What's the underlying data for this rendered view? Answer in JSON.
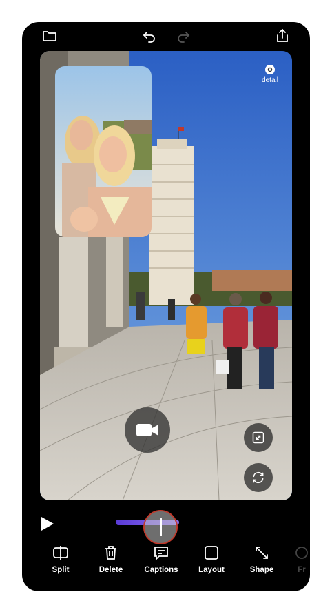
{
  "header": {
    "folder_icon": "folder-icon",
    "undo_icon": "undo-icon",
    "redo_icon": "redo-icon",
    "share_icon": "share-icon"
  },
  "canvas": {
    "detail_label": "detail",
    "expand_icon": "expand-icon",
    "rotate_icon": "rotate-camera-icon",
    "camera_icon": "video-camera-icon"
  },
  "playback": {
    "play_icon": "play-icon",
    "progress_fraction": 0.5
  },
  "toolbar": {
    "items": [
      {
        "label": "Split",
        "icon": "split-icon"
      },
      {
        "label": "Delete",
        "icon": "trash-icon"
      },
      {
        "label": "Captions",
        "icon": "captions-icon"
      },
      {
        "label": "Layout",
        "icon": "layout-icon"
      },
      {
        "label": "Shape",
        "icon": "shape-icon"
      },
      {
        "label": "Fr",
        "icon": "frame-icon"
      }
    ]
  },
  "colors": {
    "accent": "#6a4be0",
    "scrubber_ring": "#c0392b",
    "background": "#000000"
  }
}
